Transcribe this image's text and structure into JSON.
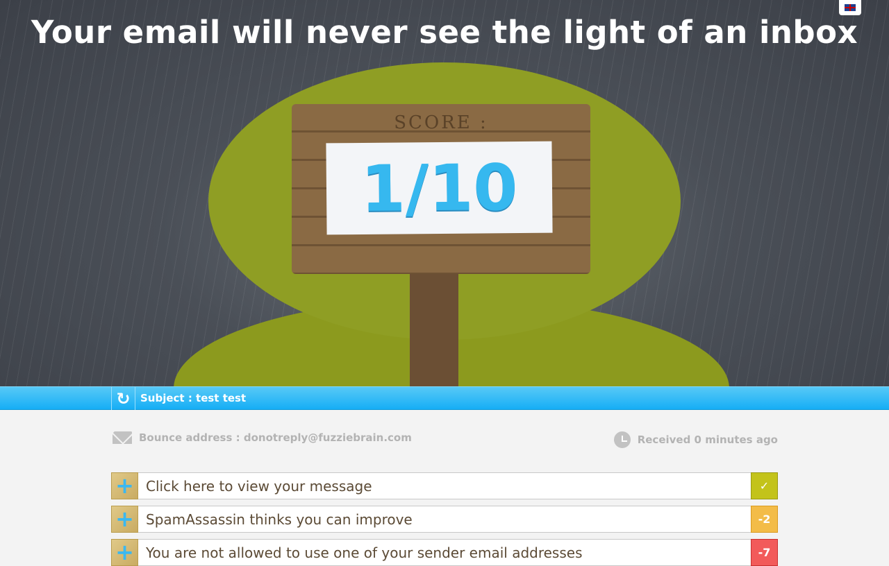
{
  "header": {
    "title": "Your email will never see the light of an inbox",
    "language": "English"
  },
  "score": {
    "label": "SCORE :",
    "value": "1/10"
  },
  "subject_bar": {
    "subject": "Subject : test test"
  },
  "meta": {
    "bounce": "Bounce address : donotreply@fuzziebrain.com",
    "received": "Received 0 minutes ago"
  },
  "rows": [
    {
      "text": "Click here to view your message",
      "badge": "✓",
      "color": "#c3c31a"
    },
    {
      "text": "SpamAssassin thinks you can improve",
      "badge": "-2",
      "color": "#f3bc48"
    },
    {
      "text": "You are not allowed to use one of your sender email addresses",
      "badge": "-7",
      "color": "#f25a5a"
    }
  ]
}
